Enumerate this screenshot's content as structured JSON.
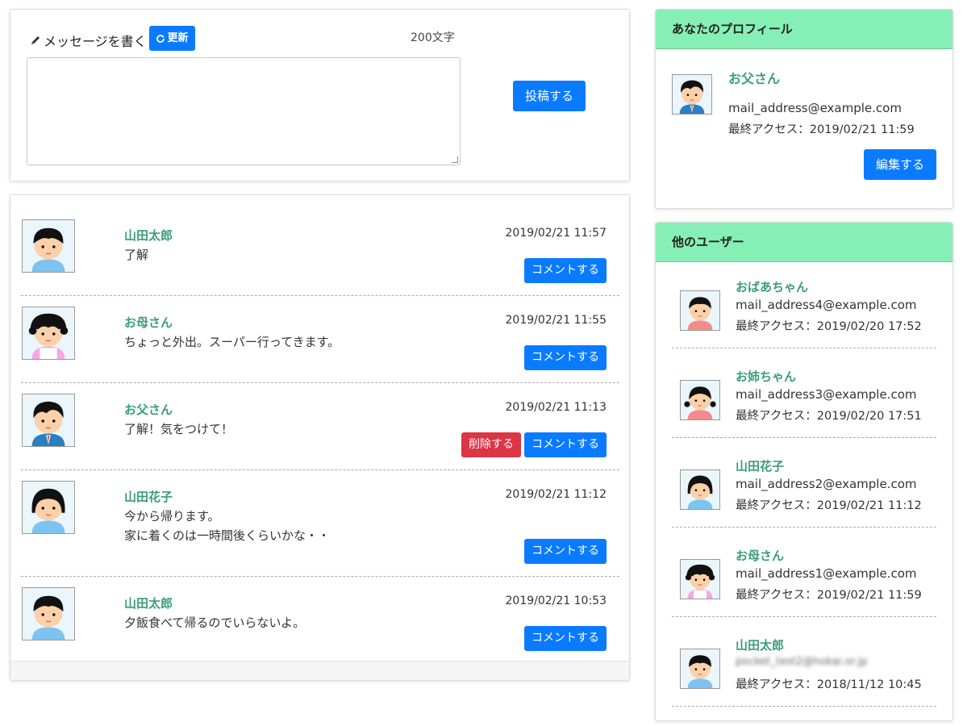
{
  "compose": {
    "label": "メッセージを書く",
    "refresh_label": "更新",
    "char_count": "200文字",
    "textarea_value": "",
    "post_label": "投稿する"
  },
  "feed": [
    {
      "name": "山田太郎",
      "time": "2019/02/21 11:57",
      "text": "了解",
      "comment_label": "コメントする",
      "delete_label": "",
      "avatar": "boy"
    },
    {
      "name": "お母さん",
      "time": "2019/02/21 11:55",
      "text": "ちょっと外出。スーパー行ってきます。",
      "comment_label": "コメントする",
      "delete_label": "",
      "avatar": "mother"
    },
    {
      "name": "お父さん",
      "time": "2019/02/21 11:13",
      "text": "了解！気をつけて！",
      "comment_label": "コメントする",
      "delete_label": "削除する",
      "avatar": "father"
    },
    {
      "name": "山田花子",
      "time": "2019/02/21 11:12",
      "text": "今から帰ります。\n家に着くのは一時間後くらいかな・・",
      "comment_label": "コメントする",
      "delete_label": "",
      "avatar": "girl"
    },
    {
      "name": "山田太郎",
      "time": "2019/02/21 10:53",
      "text": "夕飯食べて帰るのでいらないよ。",
      "comment_label": "コメントする",
      "delete_label": "",
      "avatar": "boy"
    }
  ],
  "profile": {
    "header": "あなたのプロフィール",
    "name": "お父さん",
    "email": "mail_address@example.com",
    "last_access": "最終アクセス：2019/02/21 11:59",
    "edit_label": "編集する"
  },
  "others": {
    "header": "他のユーザー",
    "users": [
      {
        "name": "おばあちゃん",
        "email": "mail_address4@example.com",
        "last_access": "最終アクセス：2019/02/20 17:52",
        "avatar": "grandma"
      },
      {
        "name": "お姉ちゃん",
        "email": "mail_address3@example.com",
        "last_access": "最終アクセス：2019/02/20 17:51",
        "avatar": "sister"
      },
      {
        "name": "山田花子",
        "email": "mail_address2@example.com",
        "last_access": "最終アクセス：2019/02/21 11:12",
        "avatar": "girl"
      },
      {
        "name": "お母さん",
        "email": "mail_address1@example.com",
        "last_access": "最終アクセス：2019/02/21 11:59",
        "avatar": "mother"
      },
      {
        "name": "山田太郎",
        "email": "pocket_test2@hokai.or.jp",
        "last_access": "最終アクセス：2018/11/12 10:45",
        "avatar": "boy"
      }
    ]
  },
  "colors": {
    "accent": "#0a7bff",
    "danger": "#dc3545",
    "header_bg": "#86efb5",
    "name_color": "#3a9d7a"
  }
}
